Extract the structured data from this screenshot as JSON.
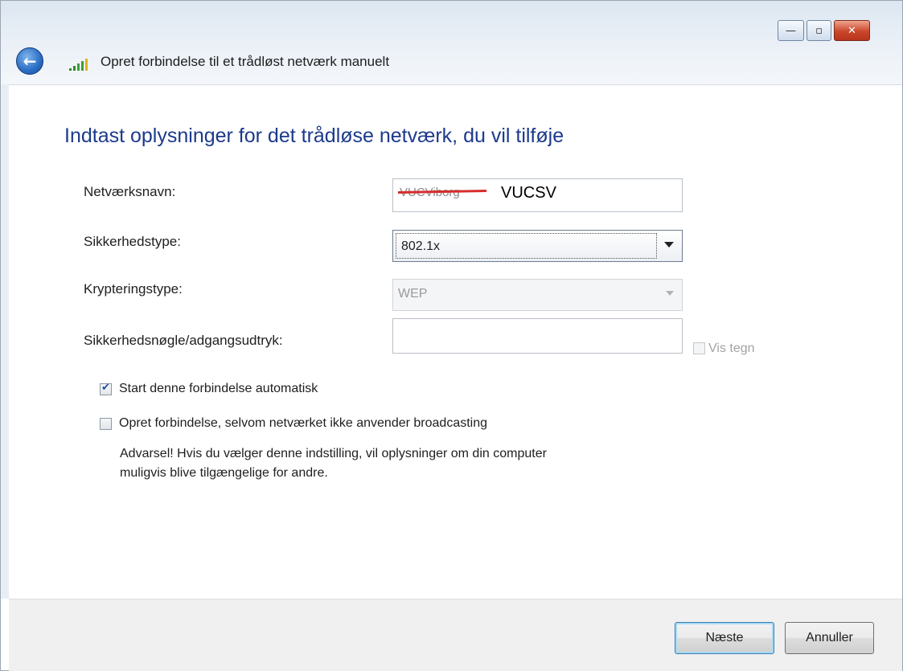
{
  "window": {
    "controls": {
      "minimize": "—",
      "maximize": "▫",
      "close": "✕"
    },
    "title": "Opret forbindelse til et trådløst netværk manuelt"
  },
  "heading": "Indtast oplysninger for det trådløse netværk, du vil tilføje",
  "form": {
    "network_name": {
      "label": "Netværksnavn:",
      "struck_value": "VUCViborg",
      "value": "VUCSV"
    },
    "security_type": {
      "label": "Sikkerhedstype:",
      "value": "802.1x"
    },
    "encryption_type": {
      "label": "Krypteringstype:",
      "value": "WEP",
      "disabled": true
    },
    "security_key": {
      "label": "Sikkerhedsnøgle/adgangsudtryk:",
      "value": "",
      "show_chars_label": "Vis tegn"
    },
    "auto_start": {
      "label": "Start denne forbindelse automatisk",
      "checked": true
    },
    "connect_hidden": {
      "label": "Opret forbindelse, selvom netværket ikke anvender broadcasting",
      "checked": false,
      "warning_line1": "Advarsel! Hvis du vælger denne indstilling, vil oplysninger om din computer",
      "warning_line2": "muligvis blive tilgængelige for andre."
    }
  },
  "buttons": {
    "next": "Næste",
    "cancel": "Annuller"
  },
  "colors": {
    "heading": "#1c3a8c",
    "strike": "#d62c2c",
    "footer": "#f0f0f0"
  }
}
